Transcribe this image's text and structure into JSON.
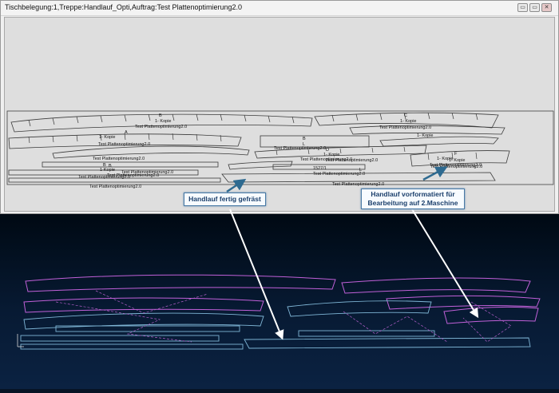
{
  "window": {
    "title": "Tischbelegung:1,Treppe:Handlauf_Opti,Auftrag:Test Plattenoptimierung2.0",
    "buttons": {
      "minimize": "▭",
      "maximize": "▭",
      "close": "✕"
    }
  },
  "parts": {
    "labels": [
      "B",
      "1- Kopie",
      "Test Plattenoptimierung2.0",
      "A",
      "1- Kopie",
      "Test Plattenoptimierung2.0",
      "Test Plattenoptimierung2.0",
      "B",
      "1-Kopie",
      "Test Plattenoptimierung2.0",
      "B",
      "L",
      "C",
      "1- Kopie",
      "Test Plattenoptimierung2.0",
      "1- Kopie",
      "Test Plattenoptimierung2.0",
      "D",
      "1- Kopie",
      "Test Plattenoptimierung2.0",
      "Test Plattenoptimierung2.0",
      "1- Kopie",
      "Test Plattenoptimierung2.0",
      "F",
      "1- Kopie",
      "Test Plattenoptimierung2.0",
      "B",
      "L",
      "Test Plattenoptimierung2.0",
      "Test Plattenoptimierung2.0",
      "1527/1",
      "Test Plattenoptimierung2.0",
      "Test Plattenoptimierung2.0",
      "Test Plattenoptimierung2.0"
    ]
  },
  "callouts": {
    "left": "Handlauf fertig gefräst",
    "right_line1": "Handlauf vorformatiert für",
    "right_line2": "Bearbeitung auf 2.Maschine"
  },
  "colors": {
    "callout_border": "#4a7aa6",
    "callout_text": "#1b3f6b",
    "cam_magenta": "#c060d8",
    "cam_blue": "#7fb6d6",
    "workspace_bg": "#dedede",
    "machine_bg": "#071a33"
  }
}
